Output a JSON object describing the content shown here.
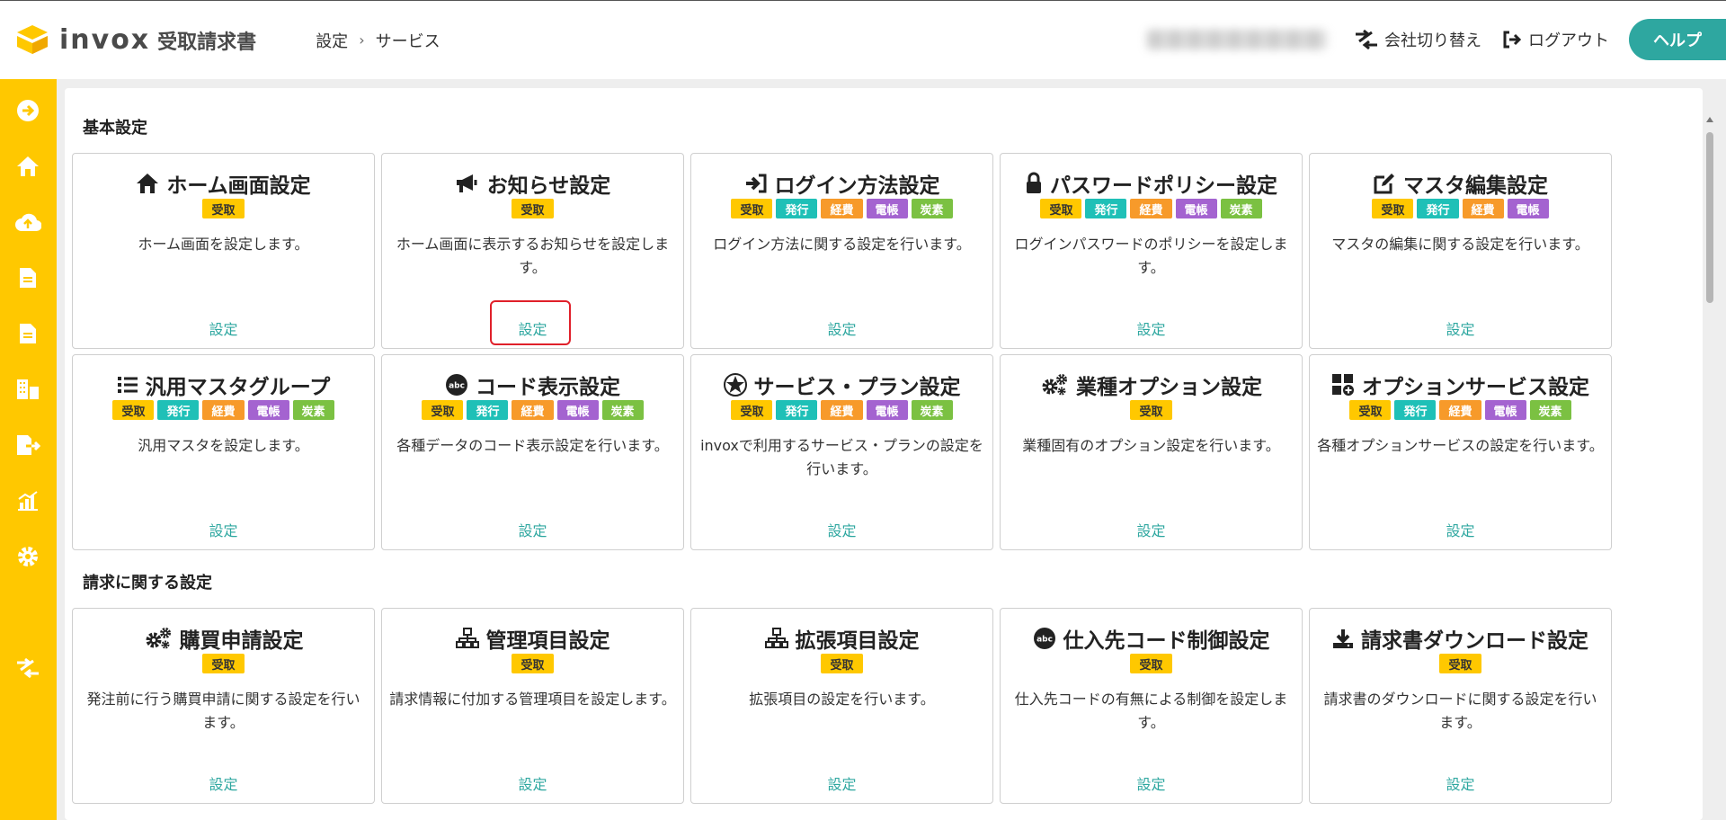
{
  "header": {
    "logo_text": "invox",
    "logo_sub": "受取請求書",
    "breadcrumb": [
      "設定",
      "サービス"
    ],
    "company_switch": "会社切り替え",
    "logout": "ログアウト",
    "help": "ヘルプ",
    "colors": {
      "accent": "#2ea7a0",
      "sidebar": "#ffc800"
    }
  },
  "sidebar": {
    "icons": [
      "arrow-right-circle-icon",
      "home-icon",
      "cloud-upload-icon",
      "document-icon",
      "document-icon",
      "building-icon",
      "export-icon",
      "chart-icon",
      "gear-icon",
      "switch-icon"
    ]
  },
  "badge_labels": {
    "rec": "受取",
    "iss": "発行",
    "exp": "経費",
    "led": "電帳",
    "car": "炭素"
  },
  "sections": [
    {
      "title": "基本設定",
      "cards": [
        {
          "icon": "home-icon",
          "title": "ホーム画面設定",
          "badges": [
            "受取"
          ],
          "desc": "ホーム画面を設定します。",
          "link": "設定"
        },
        {
          "icon": "megaphone-icon",
          "title": "お知らせ設定",
          "badges": [
            "受取"
          ],
          "desc": "ホーム画面に表示するお知らせを設定します。",
          "link": "設定"
        },
        {
          "icon": "sign-in-icon",
          "title": "ログイン方法設定",
          "badges": [
            "受取",
            "発行",
            "経費",
            "電帳",
            "炭素"
          ],
          "desc": "ログイン方法に関する設定を行います。",
          "link": "設定"
        },
        {
          "icon": "lock-icon",
          "title": "パスワードポリシー設定",
          "badges": [
            "受取",
            "発行",
            "経費",
            "電帳",
            "炭素"
          ],
          "desc": "ログインパスワードのポリシーを設定します。",
          "link": "設定"
        },
        {
          "icon": "edit-icon",
          "title": "マスタ編集設定",
          "badges": [
            "受取",
            "発行",
            "経費",
            "電帳"
          ],
          "desc": "マスタの編集に関する設定を行います。",
          "link": "設定"
        },
        {
          "icon": "list-icon",
          "title": "汎用マスタグループ",
          "badges": [
            "受取",
            "発行",
            "経費",
            "電帳",
            "炭素"
          ],
          "desc": "汎用マスタを設定します。",
          "link": "設定"
        },
        {
          "icon": "abc-icon",
          "title": "コード表示設定",
          "badges": [
            "受取",
            "発行",
            "経費",
            "電帳",
            "炭素"
          ],
          "desc": "各種データのコード表示設定を行います。",
          "link": "設定"
        },
        {
          "icon": "star-badge-icon",
          "title": "サービス・プラン設定",
          "badges": [
            "受取",
            "発行",
            "経費",
            "電帳",
            "炭素"
          ],
          "desc": "invoxで利用するサービス・プランの設定を行います。",
          "link": "設定"
        },
        {
          "icon": "gears-icon",
          "title": "業種オプション設定",
          "badges": [
            "受取"
          ],
          "desc": "業種固有のオプション設定を行います。",
          "link": "設定"
        },
        {
          "icon": "grid-plus-icon",
          "title": "オプションサービス設定",
          "badges": [
            "受取",
            "発行",
            "経費",
            "電帳",
            "炭素"
          ],
          "desc": "各種オプションサービスの設定を行います。",
          "link": "設定"
        }
      ]
    },
    {
      "title": "請求に関する設定",
      "cards": [
        {
          "icon": "gears-icon",
          "title": "購買申請設定",
          "badges": [
            "受取"
          ],
          "desc": "発注前に行う購買申請に関する設定を行います。",
          "link": "設定"
        },
        {
          "icon": "hierarchy-icon",
          "title": "管理項目設定",
          "badges": [
            "受取"
          ],
          "desc": "請求情報に付加する管理項目を設定します。",
          "link": "設定"
        },
        {
          "icon": "hierarchy-icon",
          "title": "拡張項目設定",
          "badges": [
            "受取"
          ],
          "desc": "拡張項目の設定を行います。",
          "link": "設定"
        },
        {
          "icon": "abc-icon",
          "title": "仕入先コード制御設定",
          "badges": [
            "受取"
          ],
          "desc": "仕入先コードの有無による制御を設定します。",
          "link": "設定"
        },
        {
          "icon": "download-icon",
          "title": "請求書ダウンロード設定",
          "badges": [
            "受取"
          ],
          "desc": "請求書のダウンロードに関する設定を行います。",
          "link": "設定"
        }
      ]
    }
  ]
}
